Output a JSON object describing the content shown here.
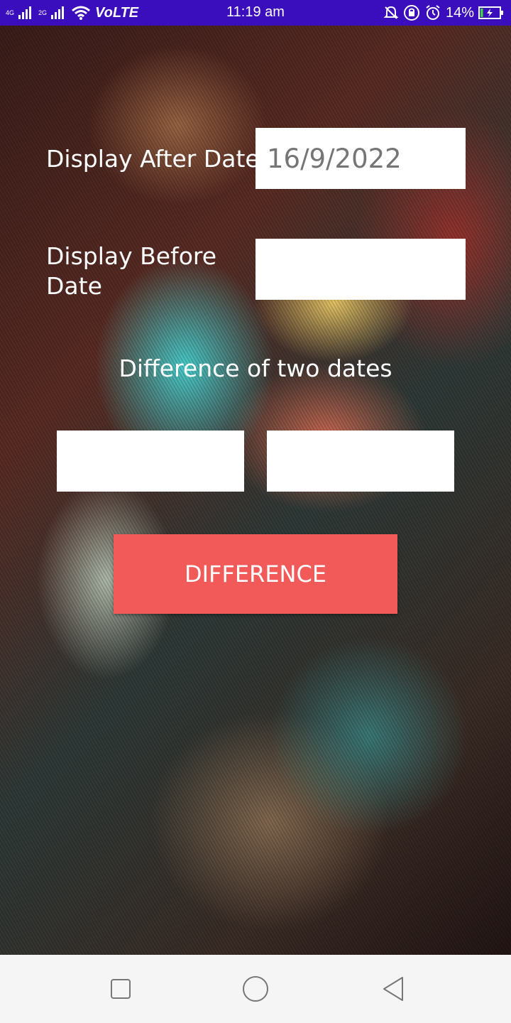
{
  "status_bar": {
    "network_left": "4G",
    "network_right": "2G",
    "volte": "VoLTE",
    "time": "11:19 am",
    "battery_percent": "14%",
    "battery_level": 0.14,
    "icons": [
      "signal-icon",
      "signal-icon",
      "wifi-icon",
      "mute-icon",
      "lock-rotation-icon",
      "alarm-icon",
      "battery-charging-icon"
    ]
  },
  "form": {
    "after_label": "Display After Date",
    "after_value": "16/9/2022",
    "before_label_line1": "Display Before",
    "before_label_line2": "Date",
    "before_value": "",
    "difference_heading": "Difference of two dates",
    "result_left": "",
    "result_right": "",
    "button_label": "DIFFERENCE"
  },
  "colors": {
    "status_bar": "#3a0dbd",
    "button": "#f25a5a",
    "field_background": "#ffffff",
    "navbar": "#f5f5f5"
  },
  "navbar": {
    "icons": [
      "recent-apps-icon",
      "home-icon",
      "back-icon"
    ]
  }
}
